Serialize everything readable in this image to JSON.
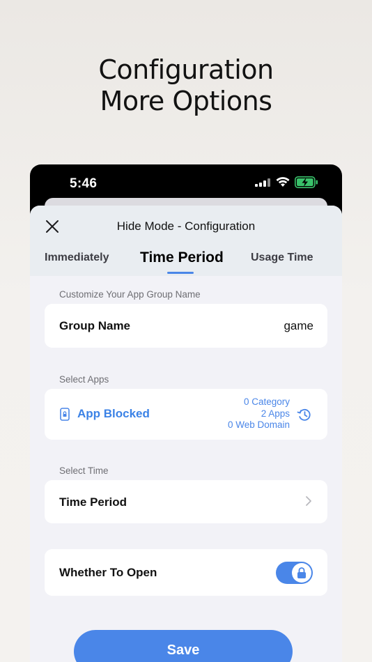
{
  "promo": {
    "line1": "Configuration",
    "line2": "More Options"
  },
  "status_bar": {
    "time": "5:46"
  },
  "sheet": {
    "title": "Hide Mode - Configuration",
    "tabs": [
      {
        "label": "Immediately",
        "active": false
      },
      {
        "label": "Time Period",
        "active": true
      },
      {
        "label": "Usage Time",
        "active": false
      }
    ]
  },
  "group_section": {
    "label": "Customize Your App Group Name",
    "row_label": "Group Name",
    "row_value": "game"
  },
  "apps_section": {
    "label": "Select Apps",
    "row_label": "App Blocked",
    "category_count": "0 Category",
    "apps_count": "2 Apps",
    "web_domain_count": "0 Web Domain"
  },
  "time_section": {
    "label": "Select Time",
    "row_label": "Time Period"
  },
  "open_section": {
    "row_label": "Whether To Open",
    "toggle_on": true
  },
  "save_label": "Save",
  "colors": {
    "accent": "#4a86e8",
    "sheet_background": "#f2f2f7",
    "header_background": "#e9edf1"
  },
  "icons": [
    "close-icon",
    "lock-icon",
    "history-icon",
    "chevron-right-icon",
    "signal-icon",
    "wifi-icon",
    "battery-icon"
  ]
}
